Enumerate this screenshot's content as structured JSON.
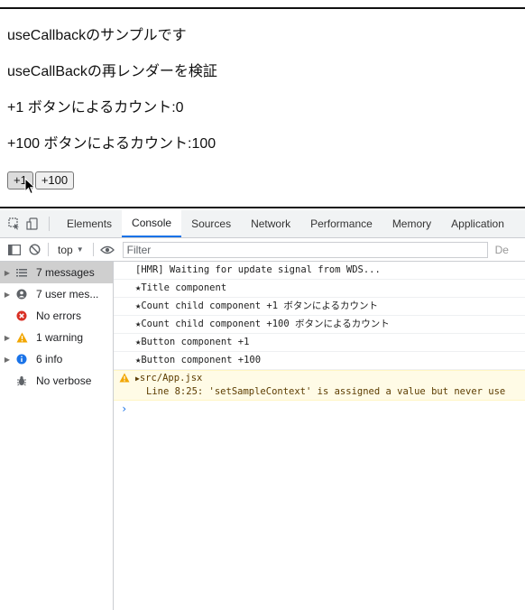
{
  "app": {
    "line1": "useCallbackのサンプルです",
    "line2": "useCallBackの再レンダーを検証",
    "line3": "+1 ボタンによるカウント:0",
    "line4": "+100 ボタンによるカウント:100",
    "btn_plus1": "+1",
    "btn_plus100": "+100"
  },
  "devtools": {
    "tabs": [
      "Elements",
      "Console",
      "Sources",
      "Network",
      "Performance",
      "Memory",
      "Application"
    ],
    "active_tab": "Console",
    "context": "top",
    "filter_placeholder": "Filter",
    "default_levels": "De",
    "sidebar": [
      {
        "label": "7 messages",
        "icon": "list-icon"
      },
      {
        "label": "7 user mes...",
        "icon": "user-icon"
      },
      {
        "label": "No errors",
        "icon": "error-icon"
      },
      {
        "label": "1 warning",
        "icon": "warning-icon"
      },
      {
        "label": "6 info",
        "icon": "info-icon"
      },
      {
        "label": "No verbose",
        "icon": "bug-icon"
      }
    ],
    "messages": [
      "[HMR] Waiting for update signal from WDS...",
      "★Title component",
      "★Count child component +1 ボタンによるカウント",
      "★Count child component +100 ボタンによるカウント",
      "★Button component +1",
      "★Button component +100"
    ],
    "warning": {
      "file": "src/App.jsx",
      "detail": "Line 8:25:  'setSampleContext' is assigned a value but never use"
    },
    "prompt": "›",
    "colors": {
      "accent": "#1a73e8",
      "warning_bg": "#fffbe6",
      "error": "#d93025",
      "info": "#1a73e8"
    }
  }
}
